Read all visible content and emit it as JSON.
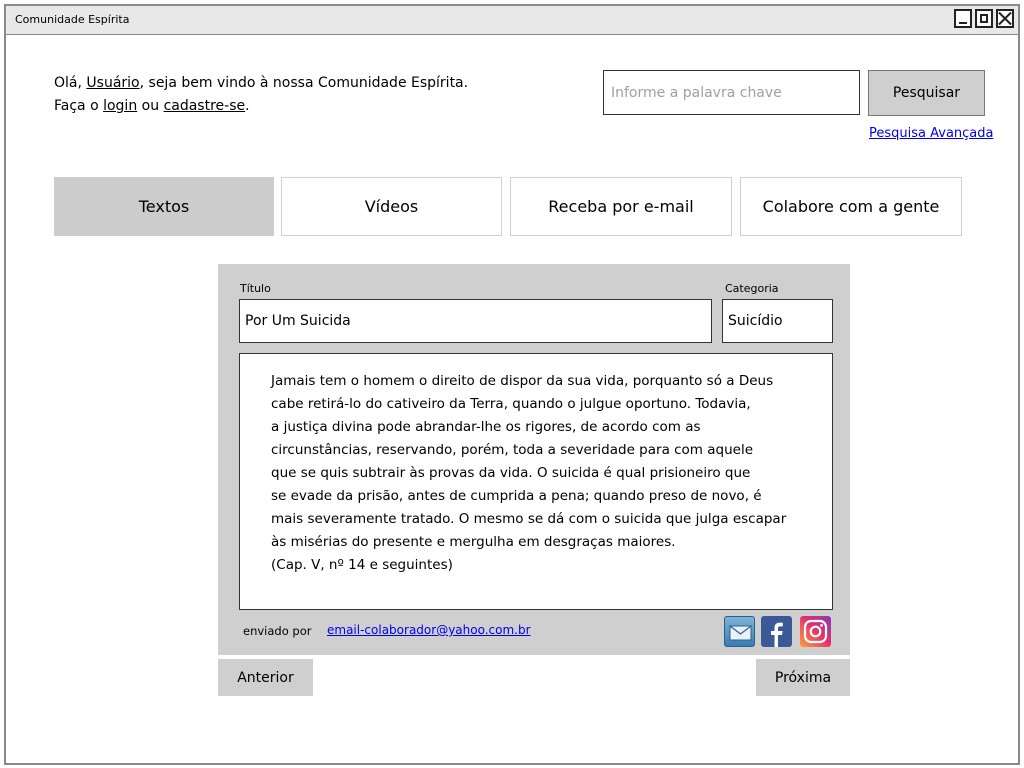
{
  "window": {
    "title": "Comunidade Espírita"
  },
  "greeting": {
    "hello": "Olá,",
    "user_link": "Usuário",
    "welcome": ", seja bem vindo à nossa Comunidade Espírita.",
    "line2_prefix": "Faça o",
    "login_link": "login",
    "or": "ou",
    "signup_link": "cadastre-se",
    "period": "."
  },
  "search": {
    "placeholder": "Informe a palavra chave",
    "value": "",
    "button_label": "Pesquisar",
    "advanced_link": "Pesquisa Avançada"
  },
  "tabs": [
    {
      "label": "Textos",
      "active": true
    },
    {
      "label": "Vídeos",
      "active": false
    },
    {
      "label": "Receba por e-mail",
      "active": false
    },
    {
      "label": "Colabore com a gente",
      "active": false
    }
  ],
  "article": {
    "title_label": "Título",
    "title_value": "Por Um Suicida",
    "category_label": "Categoria",
    "category_value": "Suicídio",
    "body": "Jamais tem o homem o direito de dispor da sua vida, porquanto só a Deus\ncabe retirá-lo do cativeiro da Terra, quando o julgue oportuno. Todavia,\na justiça divina pode abrandar-lhe os rigores, de acordo com as\ncircunstâncias, reservando, porém, toda a severidade para com aquele\nque se quis subtrair às provas da vida. O suicida é qual prisioneiro que\nse evade da prisão, antes de cumprida a pena; quando preso de novo, é\nmais severamente tratado. O mesmo se dá com o suicida que julga escapar\nàs misérias do presente e mergulha em desgraças maiores.\n(Cap. V, nº 14 e seguintes)",
    "sent_by_label": "enviado por",
    "sent_by_email": "email-colaborador@yahoo.com.br"
  },
  "share_icons": [
    "mail-icon",
    "facebook-icon",
    "instagram-icon"
  ],
  "navigation": {
    "prev_label": "Anterior",
    "next_label": "Próxima"
  },
  "colors": {
    "active_tab": "#cccccc",
    "panel": "#cfcfcf",
    "link": "#0000ee"
  }
}
